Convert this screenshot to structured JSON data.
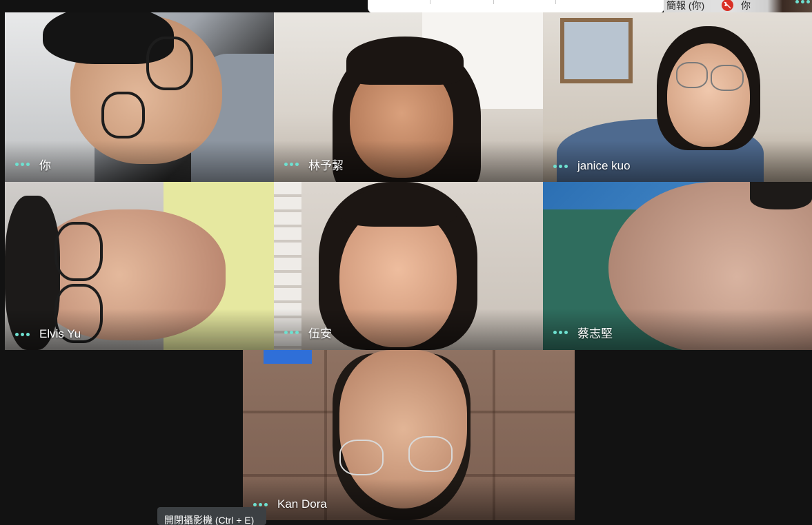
{
  "topbar": {
    "presentation_label": "簡報 (你)",
    "self_label": "你",
    "mute_icon": "mic-off-icon",
    "more_icon": "more-options-icon"
  },
  "accent": {
    "dots": "#6ee0d0",
    "mute": "#d93025",
    "tooltip_bg": "#3c4043"
  },
  "participants": [
    {
      "name": "你",
      "more_icon": "more-options-icon"
    },
    {
      "name": "林予絜",
      "more_icon": "more-options-icon"
    },
    {
      "name": "janice kuo",
      "more_icon": "more-options-icon"
    },
    {
      "name": "Elvis Yu",
      "more_icon": "more-options-icon"
    },
    {
      "name": "伍安",
      "more_icon": "more-options-icon"
    },
    {
      "name": "蔡志堅",
      "more_icon": "more-options-icon"
    },
    {
      "name": "Kan Dora",
      "more_icon": "more-options-icon"
    }
  ],
  "tooltip": {
    "text": "開閉攝影機 (Ctrl + E)"
  }
}
